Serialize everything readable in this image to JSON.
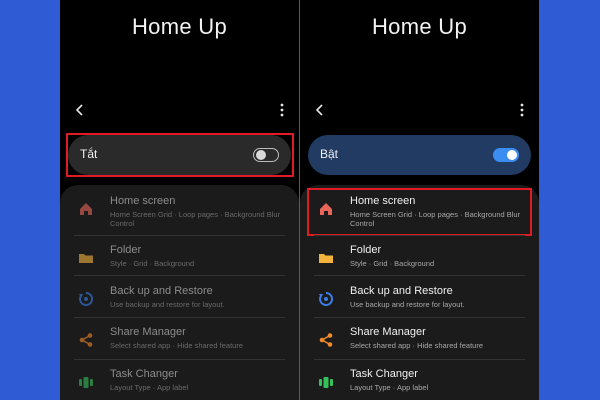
{
  "left": {
    "title": "Home Up",
    "toggle_label": "Tắt",
    "items": [
      {
        "title": "Home screen",
        "subtitle": "Home Screen Grid · Loop pages · Background Blur Control"
      },
      {
        "title": "Folder",
        "subtitle": "Style · Grid · Background"
      },
      {
        "title": "Back up and Restore",
        "subtitle": "Use backup and restore for layout."
      },
      {
        "title": "Share Manager",
        "subtitle": "Select shared app · Hide shared feature"
      },
      {
        "title": "Task Changer",
        "subtitle": "Layout Type · App label"
      }
    ]
  },
  "right": {
    "title": "Home Up",
    "toggle_label": "Bật",
    "items": [
      {
        "title": "Home screen",
        "subtitle": "Home Screen Grid · Loop pages · Background Blur Control"
      },
      {
        "title": "Folder",
        "subtitle": "Style · Grid · Background"
      },
      {
        "title": "Back up and Restore",
        "subtitle": "Use backup and restore for layout."
      },
      {
        "title": "Share Manager",
        "subtitle": "Select shared app · Hide shared feature"
      },
      {
        "title": "Task Changer",
        "subtitle": "Layout Type · App label"
      }
    ]
  },
  "colors": {
    "background": "#2f5bd4",
    "highlight": "#e01b24",
    "toggle_on": "#3b8ef0",
    "home_icon": "#e8655a",
    "folder_icon": "#f2b23c",
    "backup_icon": "#3b7de8",
    "share_icon": "#f08a2c",
    "task_icon": "#34c25a"
  },
  "icons": [
    "back-arrow-icon",
    "more-vert-icon",
    "home-icon",
    "folder-icon",
    "backup-restore-icon",
    "share-icon",
    "task-changer-icon"
  ]
}
